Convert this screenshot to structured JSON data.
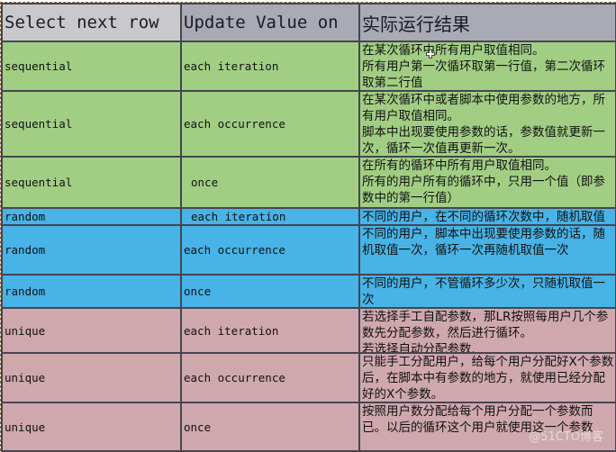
{
  "table": {
    "headers": [
      "Select next row",
      "Update Value on",
      "实际运行结果"
    ],
    "rows": [
      {
        "select_next_row": "sequential",
        "update_value_on": "each iteration",
        "result": "在某次循环中所有用户取值相同。\n所有用户第一次循环取第一行值，第二次循环取第二行值",
        "group": "sequential"
      },
      {
        "select_next_row": "sequential",
        "update_value_on": "each occurrence",
        "result": "在某次循环中或者脚本中使用参数的地方，所有用户取值相同。\n脚本中出现要使用参数的话，参数值就更新一次，循环一次值再更新一次。",
        "group": "sequential"
      },
      {
        "select_next_row": "sequential",
        "update_value_on": "once",
        "result": "在所有的循环中所有用户取值相同。\n所有的用户所有的循环中，只用一个值（即参数中的第一行值）",
        "group": "sequential"
      },
      {
        "select_next_row": "random",
        "update_value_on": "each iteration",
        "result": "不同的用户，在不同的循环次数中，随机取值",
        "group": "random"
      },
      {
        "select_next_row": "random",
        "update_value_on": "each occurrence",
        "result": "不同的用户，脚本中出现要使用参数的话，随机取值一次，循环一次再随机取值一次",
        "group": "random"
      },
      {
        "select_next_row": "random",
        "update_value_on": "once",
        "result": "不同的用户，不管循环多少次，只随机取值一次",
        "group": "random"
      },
      {
        "select_next_row": "unique",
        "update_value_on": "each iteration",
        "result": "若选择手工自配参数，那LR按照每用户几个参数先分配参数，然后进行循环。\n若选择自动分配参数.",
        "group": "unique"
      },
      {
        "select_next_row": "unique",
        "update_value_on": "each occurrence",
        "result": "只能手工分配用户，给每个用户分配好X个参数后，在脚本中有参数的地方，就使用已经分配好的X个参数。",
        "group": "unique"
      },
      {
        "select_next_row": "unique",
        "update_value_on": "once",
        "result": "按照用户数分配给每个用户分配一个参数而已。以后的循环这个用户就使用这一个参数",
        "group": "unique"
      }
    ]
  },
  "colors": {
    "header_col1": "#c9c9cb",
    "header_col2_3": "#a9aab4",
    "sequential": "#a2ce84",
    "random": "#47b3e6",
    "unique": "#cfa8ae",
    "border": "#454550"
  },
  "watermark": "@51CTO博客"
}
